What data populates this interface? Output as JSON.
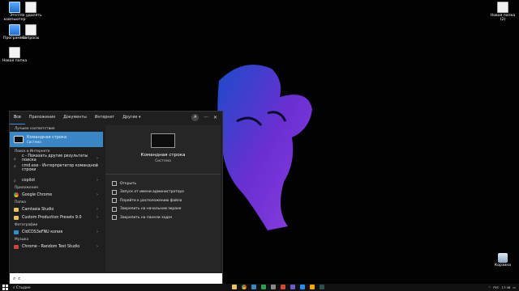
{
  "desktop": {
    "icons": [
      {
        "label": "Этот\nкомпьютер",
        "icon": "pc"
      },
      {
        "label": "Не удалять",
        "icon": "doc"
      },
      {
        "label": "Программы",
        "icon": "pc"
      },
      {
        "label": "Запросы",
        "icon": "doc"
      },
      {
        "label": "Новая папка",
        "icon": "doc"
      },
      {
        "label": "Новая папка\n(2)",
        "icon": "doc"
      },
      {
        "label": "Корзина",
        "icon": "bin"
      }
    ]
  },
  "start": {
    "tabs": [
      "Все",
      "Приложения",
      "Документы",
      "Интернет",
      "Другие ▾"
    ],
    "avatar": "A",
    "sections": {
      "best": "Лучшее соответствие",
      "web": "Поиск в Интернете",
      "apps": "Приложения",
      "folders": "Папка",
      "photos": "Фотографии",
      "music": "Музыка"
    },
    "best_match": {
      "title": "Командная строка",
      "sub": "Система"
    },
    "web_items": [
      {
        "text": "c - Показать другие результаты поиска"
      },
      {
        "text": "cmd.exe - Интерпретатор командной",
        "text2": "строки"
      },
      {
        "text": "copilot"
      }
    ],
    "apps": [
      "Google Chrome"
    ],
    "folders": [
      "Camtasia Studio",
      "Custom Production Presets 9.0"
    ],
    "photos": [
      "CldCDS3eFNU копия"
    ],
    "music": [
      "Chrome - Random Test Studio"
    ],
    "preview": {
      "title": "Командная строка",
      "sub": "Система"
    },
    "actions": [
      "Открыть",
      "Запуск от имени администратора",
      "Перейти к расположению файла",
      "Закрепить на начальном экране",
      "Закрепить на панели задач"
    ],
    "search_value": "c"
  },
  "taskbar": {
    "search_label": "Стыдие",
    "time": "17:48",
    "date": "19.02.2024",
    "lang": "РУС"
  },
  "colors": {
    "accent": "#3a87c8",
    "panel": "#1f1f1f"
  }
}
